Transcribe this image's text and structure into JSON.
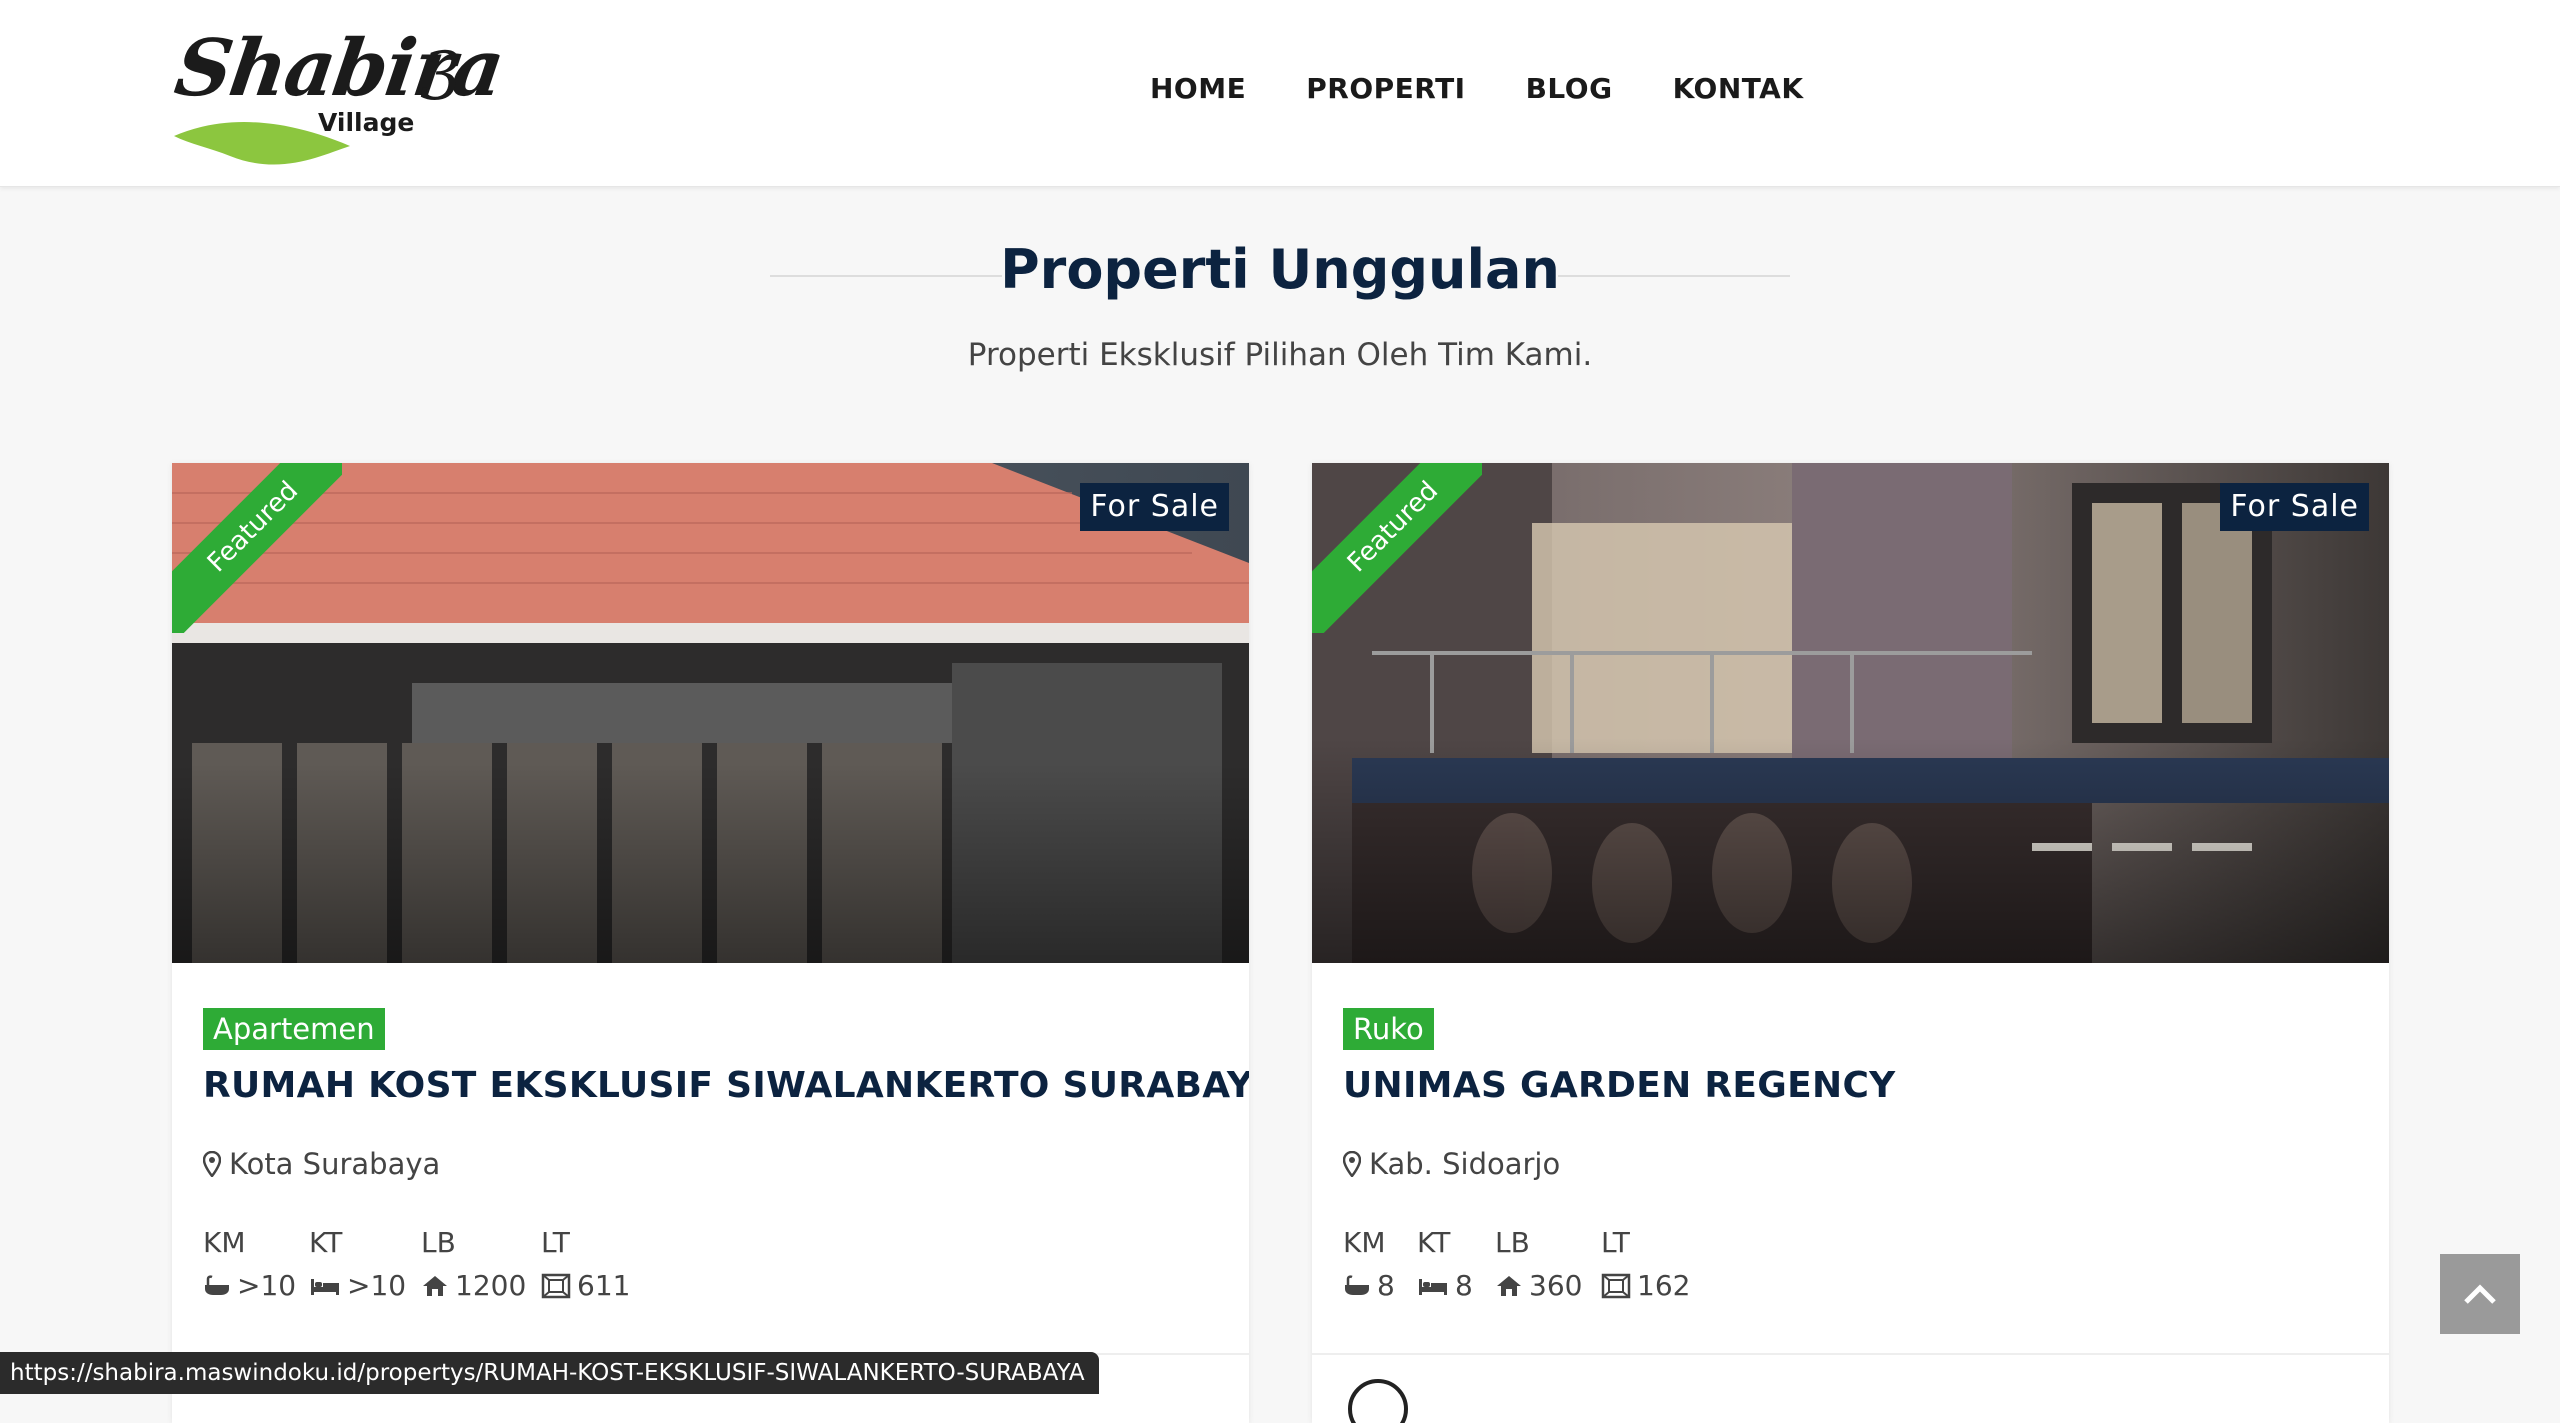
{
  "logo": {
    "title": "Shabira",
    "number": "3",
    "subtitle": "Village"
  },
  "nav": {
    "items": [
      "HOME",
      "PROPERTI",
      "BLOG",
      "KONTAK"
    ]
  },
  "section": {
    "title": "Properti Unggulan",
    "subtitle": "Properti Eksklusif Pilihan Oleh Tim Kami."
  },
  "cards": [
    {
      "ribbon": "Featured",
      "status": "For Sale",
      "type": "Apartemen",
      "title": "RUMAH KOST EKSKLUSIF SIWALANKERTO SURABAYA",
      "location": "Kota Surabaya",
      "specs": [
        {
          "label": "KM",
          "value": ">10",
          "icon": "bath-icon"
        },
        {
          "label": "KT",
          "value": ">10",
          "icon": "bed-icon"
        },
        {
          "label": "LB",
          "value": "1200",
          "icon": "home-icon"
        },
        {
          "label": "LT",
          "value": "611",
          "icon": "land-area-icon"
        }
      ]
    },
    {
      "ribbon": "Featured",
      "status": "For Sale",
      "type": "Ruko",
      "title": "UNIMAS GARDEN REGENCY",
      "location": "Kab. Sidoarjo",
      "specs": [
        {
          "label": "KM",
          "value": "8",
          "icon": "bath-icon"
        },
        {
          "label": "KT",
          "value": "8",
          "icon": "bed-icon"
        },
        {
          "label": "LB",
          "value": "360",
          "icon": "home-icon"
        },
        {
          "label": "LT",
          "value": "162",
          "icon": "land-area-icon"
        }
      ]
    }
  ],
  "status_bar": {
    "url": "https://shabira.maswindoku.id/propertys/RUMAH-KOST-EKSKLUSIF-SIWALANKERTO-SURABAYA"
  },
  "colors": {
    "navy": "#0c2340",
    "green": "#2eab36"
  }
}
